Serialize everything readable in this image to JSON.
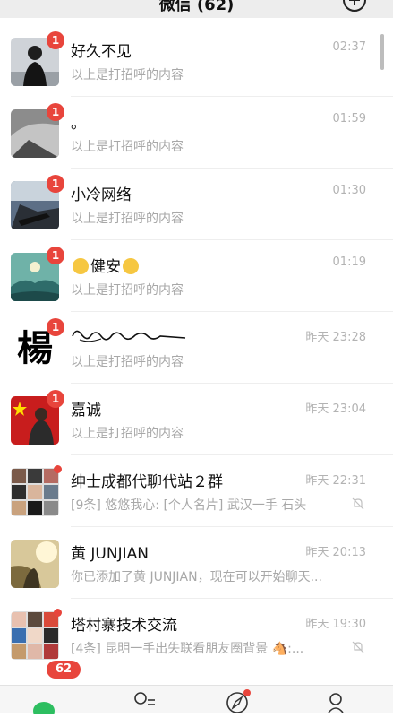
{
  "header": {
    "title": "微信 (62)"
  },
  "chats": [
    {
      "name": "好久不见",
      "time": "02:37",
      "message": "以上是打招呼的内容",
      "badge": "1"
    },
    {
      "name": "。",
      "time": "01:59",
      "message": "以上是打招呼的内容",
      "badge": "1"
    },
    {
      "name": "小冷网络",
      "time": "01:30",
      "message": "以上是打招呼的内容",
      "badge": "1"
    },
    {
      "name": "健安",
      "time": "01:19",
      "message": "以上是打招呼的内容",
      "badge": "1"
    },
    {
      "name": "",
      "time": "昨天 23:28",
      "message": "以上是打招呼的内容",
      "badge": "1",
      "avatar_text": "楊"
    },
    {
      "name": "嘉诚",
      "time": "昨天 23:04",
      "message": "以上是打招呼的内容",
      "badge": "1"
    },
    {
      "name": "绅士成都代聊代站２群",
      "time": "昨天 22:31",
      "message": "[9条] 悠悠我心: [个人名片] 武汉一手  石头"
    },
    {
      "name": "黄 JUNJIAN",
      "time": "昨天 20:13",
      "message": "你已添加了黄 JUNJIAN，现在可以开始聊天..."
    },
    {
      "name": "塔村寨技术交流",
      "time": "昨天 19:30",
      "message": "[4条] 昆明一手出失联看朋友圈背景 🐴:..."
    }
  ],
  "tabbar": {
    "chats_badge": "62"
  },
  "colors": {
    "badge": "#e8453c",
    "background": "#ffffff",
    "header": "#ededed",
    "time": "#b3b3b3",
    "message": "#a8a8a8"
  }
}
